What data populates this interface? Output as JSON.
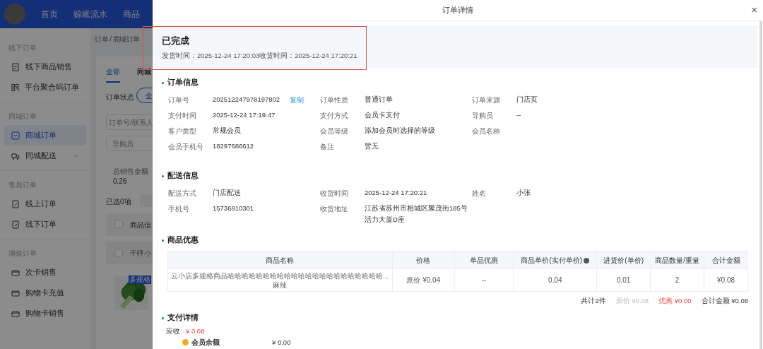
{
  "top_nav": {
    "items": [
      {
        "label": "首页",
        "selected": false
      },
      {
        "label": "赊账流水",
        "selected": false
      },
      {
        "label": "商品",
        "selected": false
      }
    ]
  },
  "sidebar": {
    "groups": [
      {
        "title": "线下订单",
        "items": [
          {
            "label": "线下商品销售",
            "selected": false
          },
          {
            "label": "平台聚合码订单",
            "selected": false
          }
        ]
      },
      {
        "title": "商城订单",
        "items": [
          {
            "label": "商城订单",
            "selected": true
          },
          {
            "label": "同城配送",
            "selected": false,
            "expandable": true
          }
        ]
      },
      {
        "title": "售后订单",
        "items": [
          {
            "label": "线上订单",
            "selected": false
          },
          {
            "label": "线下订单",
            "selected": false
          }
        ]
      },
      {
        "title": "增值订单",
        "items": [
          {
            "label": "次卡销售",
            "selected": false
          },
          {
            "label": "购物卡充值",
            "selected": false
          },
          {
            "label": "购物卡销售",
            "selected": false
          }
        ]
      }
    ]
  },
  "background_page": {
    "breadcrumb": "订单 / 商城订单",
    "tabs": [
      {
        "label": "全部",
        "selected": true
      },
      {
        "label": "同城",
        "selected": false
      }
    ],
    "status_filter_label": "订单状态",
    "status_filter_option": "全",
    "search_placeholder": "订单号/联系人",
    "guide_placeholder": "导购员",
    "total_label": "总销售金额",
    "total_value": "0.26",
    "selected_count": "已选0项",
    "header_checked": false,
    "table_header": "商品信",
    "row_checked": false,
    "row_store": "千呼小",
    "product_badge": "多规格"
  },
  "drawer": {
    "title": "订单详情",
    "close": "×",
    "status": {
      "title": "已完成",
      "times": "发货时间：2025-12-24 17:20:03收货时间：2025-12-24 17:20:21",
      "highlighted": true
    },
    "sections": [
      {
        "title": "订单信息",
        "rows": [
          [
            {
              "label": "订单号",
              "value": "202512247978197802",
              "action": "复制"
            },
            {
              "label": "订单性质",
              "value": "普通订单"
            },
            {
              "label": "订单来源",
              "value": "门店页"
            }
          ],
          [
            {
              "label": "支付时间",
              "value": "2025-12-24 17:19:47"
            },
            {
              "label": "支付方式",
              "value": "会员卡支付"
            },
            {
              "label": "导购员",
              "value": "--"
            }
          ],
          [
            {
              "label": "客户类型",
              "value": "常规会员"
            },
            {
              "label": "会员等级",
              "value": "添加会员时选择的等级"
            },
            {
              "label": "会员名称"
            }
          ],
          [
            {
              "label": "会员手机号",
              "value": "18297686612"
            },
            {
              "label": "备注",
              "value": "暂无"
            }
          ]
        ]
      },
      {
        "title": "配送信息",
        "rows": [
          [
            {
              "label": "配送方式",
              "value": "门店配送"
            },
            {
              "label": "收货时间",
              "value": "2025-12-24 17:20:21"
            },
            {
              "label": "姓名",
              "value": "小张"
            }
          ],
          [
            {
              "label": "手机号",
              "value": "15736910301"
            },
            {
              "label": "收货地址",
              "value": "江苏省苏州市相城区聚茂街185号活力大厦D座"
            }
          ]
        ]
      }
    ],
    "goods": {
      "title": "商品优惠",
      "columns": [
        "商品名称",
        "价格",
        "单品优惠",
        "商品单价(实付单价)",
        "进货价(单价)",
        "商品数量/重量",
        "合计金额"
      ],
      "rows": [
        {
          "name": "云小店多规格商品哈哈哈哈哈哈哈哈哈哈哈哈哈哈哈哈哈哈哈哈哈哈...",
          "spec": "麻辣",
          "price": "原价 ¥0.04",
          "discount": "--",
          "unit_price": "0.04",
          "cost": "0.01",
          "quantity": "2",
          "total": "¥0.08"
        }
      ],
      "summary": {
        "count": "共计2件",
        "original": "原价 ¥0.08",
        "discount": "优惠 ¥0.00",
        "total": "合计金额 ¥0.08"
      }
    },
    "payment": {
      "title": "支付详情",
      "receivable_label": "应收",
      "receivable_value": "¥ 0.08",
      "method": "会员余额",
      "method_value": "¥ 0.00"
    }
  }
}
